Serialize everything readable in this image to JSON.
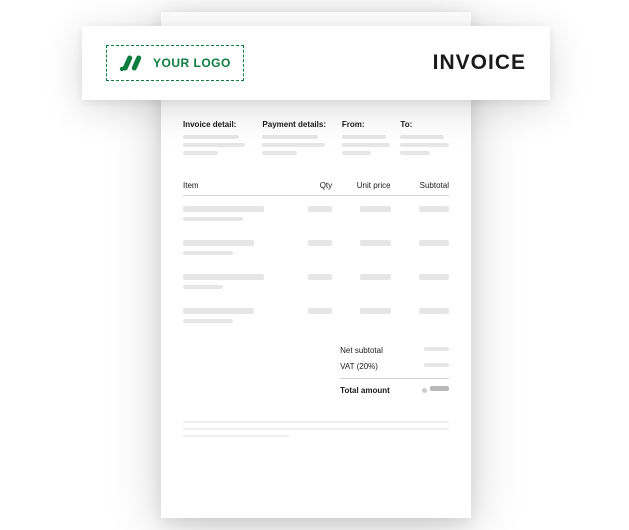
{
  "header": {
    "logo_text": "YOUR LOGO",
    "title": "INVOICE"
  },
  "details": {
    "invoice_detail_label": "Invoice detail:",
    "payment_details_label": "Payment details:",
    "from_label": "From:",
    "to_label": "To:"
  },
  "table": {
    "columns": {
      "item": "Item",
      "qty": "Qty",
      "unit_price": "Unit price",
      "subtotal": "Subtotal"
    }
  },
  "summary": {
    "net_subtotal_label": "Net subtotal",
    "vat_label": "VAT (20%)",
    "total_label": "Total amount"
  }
}
